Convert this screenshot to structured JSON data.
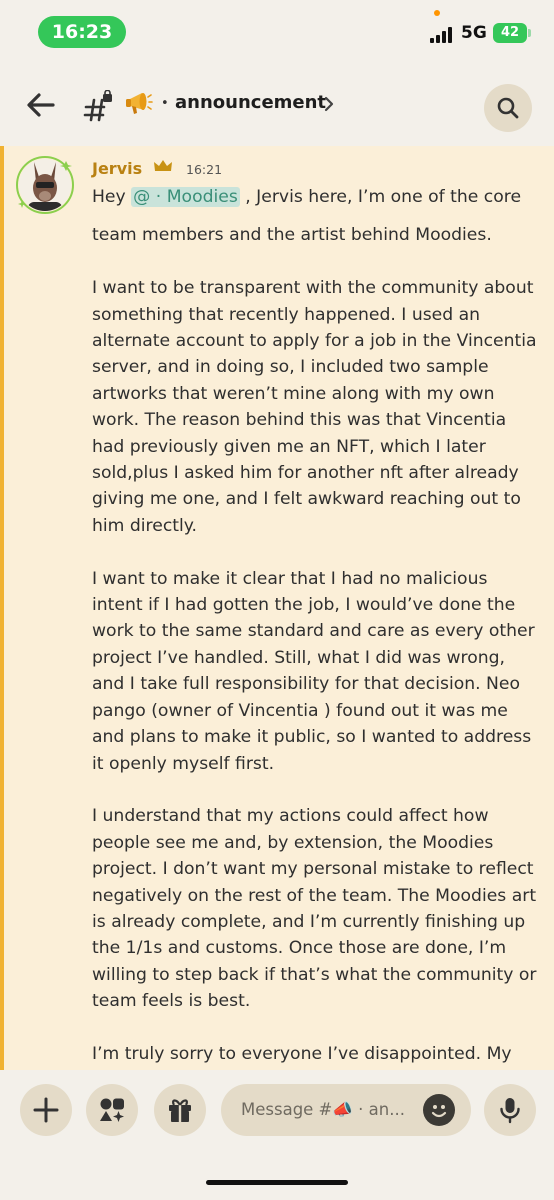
{
  "status_bar": {
    "time": "16:23",
    "network": "5G",
    "battery": "42"
  },
  "header": {
    "channel_name": "announcement",
    "separator": "•"
  },
  "message": {
    "author": "Jervis",
    "timestamp": "16:21",
    "line1_pre": "Hey ",
    "mention": "@ · Moodies",
    "line1_post": " , Jervis here, I’m one of the core",
    "line2": "team members and the artist behind Moodies.",
    "paragraphs": [
      "I want to be transparent with the community about something that recently happened. I used an alternate account to apply for a job in the Vincentia server, and in doing so, I included two sample artworks that weren’t mine along with my own work. The reason behind this was that Vincentia had previously given me an NFT, which I later sold,plus I asked him for another nft after already giving me one, and I felt awkward reaching out to him directly.",
      "I want to make it clear that I had no malicious intent if I had gotten the job, I would’ve done the work to the same standard and care as every other project I’ve handled. Still, what I did was wrong, and I take full responsibility for that decision. Neo pango (owner of Vincentia ) found out it was me and plans to make it public, so I wanted to address it openly myself first.",
      "I understand that my actions could affect how people see me and, by extension, the Moodies project. I don’t want my personal mistake to reflect negatively on the rest of the team. The Moodies art is already complete, and I’m currently finishing up the 1/1s and customs. Once those are done, I’m willing to step back if that’s what the community or team feels is best.",
      "I’m truly sorry to everyone I’ve disappointed. My goal has always been to bring authenticity and emotion through my art, and I’ll continue to hold myself accountable to that standard. Thank you for"
    ]
  },
  "composer": {
    "placeholder": "Message #📣 · an..."
  },
  "colors": {
    "accent_bar": "#f0b232",
    "author_name": "#b98112",
    "message_bg": "#fbefd8",
    "button_bg": "#e4dbc8"
  }
}
